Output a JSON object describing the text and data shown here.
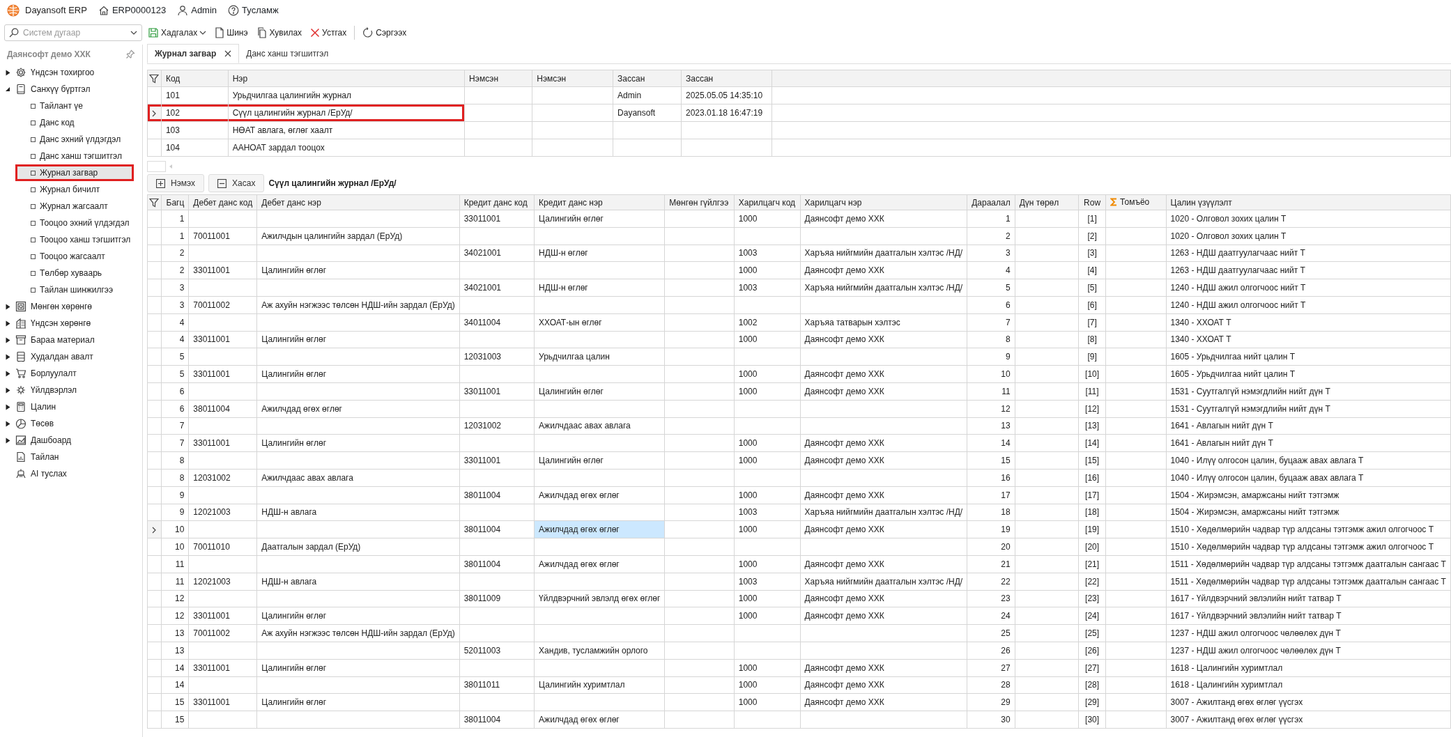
{
  "header": {
    "app_name": "Dayansoft ERP",
    "items": [
      {
        "kind": "company",
        "label": "ERP0000123"
      },
      {
        "kind": "user",
        "label": "Admin"
      },
      {
        "kind": "help",
        "label": "Тусламж"
      }
    ]
  },
  "toolbar": {
    "search": {
      "placeholder": "Систем дугаар"
    },
    "buttons": [
      {
        "kind": "save",
        "label": "Хадгалах",
        "has_menu": true
      },
      {
        "kind": "new",
        "label": "Шинэ",
        "has_menu": false
      },
      {
        "kind": "copy",
        "label": "Хувилах",
        "has_menu": false
      },
      {
        "kind": "delete",
        "label": "Устгах",
        "has_menu": false
      },
      {
        "kind": "refresh",
        "label": "Сэргээх",
        "has_menu": false
      }
    ]
  },
  "sidebar": {
    "title": "Даянсофт демо ХХК",
    "items": [
      {
        "kind": "folder",
        "label": "Үндсэн тохиргоо",
        "expanded": false
      },
      {
        "kind": "folder",
        "label": "Санхүү бүртгэл",
        "expanded": true,
        "children": [
          {
            "label": "Тайлант үе",
            "selected": false,
            "highlighted": false
          },
          {
            "label": "Данс код",
            "selected": false,
            "highlighted": false
          },
          {
            "label": "Данс эхний үлдэгдэл",
            "selected": false,
            "highlighted": false
          },
          {
            "label": "Данс ханш тэгшитгэл",
            "selected": false,
            "highlighted": false
          },
          {
            "label": "Журнал загвар",
            "selected": true,
            "highlighted": true
          },
          {
            "label": "Журнал бичилт",
            "selected": false,
            "highlighted": false
          },
          {
            "label": "Журнал жагсаалт",
            "selected": false,
            "highlighted": false
          },
          {
            "label": "Тооцоо эхний үлдэгдэл",
            "selected": false,
            "highlighted": false
          },
          {
            "label": "Тооцоо ханш тэгшитгэл",
            "selected": false,
            "highlighted": false
          },
          {
            "label": "Тооцоо жагсаалт",
            "selected": false,
            "highlighted": false
          },
          {
            "label": "Төлбөр хуваарь",
            "selected": false,
            "highlighted": false
          },
          {
            "label": "Тайлан шинжилгээ",
            "selected": false,
            "highlighted": false
          }
        ]
      },
      {
        "kind": "folder",
        "label": "Мөнгөн хөрөнгө",
        "expanded": false
      },
      {
        "kind": "folder",
        "label": "Үндсэн хөрөнгө",
        "expanded": false
      },
      {
        "kind": "folder",
        "label": "Бараа материал",
        "expanded": false
      },
      {
        "kind": "folder",
        "label": "Худалдан авалт",
        "expanded": false
      },
      {
        "kind": "folder",
        "label": "Борлуулалт",
        "expanded": false
      },
      {
        "kind": "folder",
        "label": "Үйлдвэрлэл",
        "expanded": false
      },
      {
        "kind": "folder",
        "label": "Цалин",
        "expanded": false
      },
      {
        "kind": "folder",
        "label": "Төсөв",
        "expanded": false
      },
      {
        "kind": "folder",
        "label": "Дашбоард",
        "expanded": false
      },
      {
        "kind": "leaf",
        "label": "Тайлан"
      },
      {
        "kind": "leaf",
        "label": "AI туслах"
      }
    ]
  },
  "tabs": [
    {
      "label": "Журнал загвар",
      "selected": true,
      "closable": true
    },
    {
      "label": "Данс ханш тэгшитгэл",
      "selected": false,
      "closable": false
    }
  ],
  "journal_table": {
    "columns": [
      "Код",
      "Нэр",
      "Нэмсэн",
      "Нэмсэн",
      "Зассан",
      "Зассан"
    ],
    "rows": [
      {
        "code": "101",
        "name": "Урьдчилгаа цалингийн журнал",
        "modified_by": "Admin",
        "modified_at": "2025.05.05 14:35:10",
        "selected": false,
        "highlighted": false
      },
      {
        "code": "102",
        "name": "Сүүл цалингийн журнал /ЕрУд/",
        "modified_by": "Dayansoft",
        "modified_at": "2023.01.18 16:47:19",
        "selected": true,
        "highlighted": true
      },
      {
        "code": "103",
        "name": "НӨАТ авлага, өглөг хаалт",
        "selected": false,
        "highlighted": false
      },
      {
        "code": "104",
        "name": "ААНОАТ зардал тооцох",
        "selected": false,
        "highlighted": false
      }
    ]
  },
  "detail_actions": {
    "buttons": [
      {
        "kind": "add",
        "label": "Нэмэх"
      },
      {
        "kind": "remove",
        "label": "Хасах"
      }
    ],
    "caption": "Сүүл цалингийн журнал /ЕрУд/"
  },
  "entries_table": {
    "columns": [
      {
        "label": "Багц",
        "kind": "number"
      },
      {
        "label": "Дебет данс код",
        "kind": "text"
      },
      {
        "label": "Дебет данс нэр",
        "kind": "text"
      },
      {
        "label": "Кредит данс код",
        "kind": "text"
      },
      {
        "label": "Кредит данс нэр",
        "kind": "text"
      },
      {
        "label": "Мөнгөн гүйлгээ",
        "kind": "text"
      },
      {
        "label": "Харилцагч код",
        "kind": "text"
      },
      {
        "label": "Харилцагч нэр",
        "kind": "text"
      },
      {
        "label": "Дараалал",
        "kind": "number"
      },
      {
        "label": "Дүн төрөл",
        "kind": "text"
      },
      {
        "label": "Row",
        "kind": "center"
      },
      {
        "label": "Томъёо",
        "kind": "formula"
      },
      {
        "label": "Цалин үзүүлэлт",
        "kind": "text"
      }
    ],
    "rows": [
      {
        "selected": false,
        "group": "1",
        "credit_code": "33011001",
        "credit_name": "Цалингийн өглөг",
        "partner_code": "1000",
        "partner_name": "Даянсофт демо ХХК",
        "sequence": "1",
        "row_ref": "[1]",
        "indicator": "1020 - Олговол зохих цалин Т"
      },
      {
        "selected": false,
        "group": "1",
        "debit_code": "70011001",
        "debit_name": "Ажилчдын цалингийн зардал (ЕрУд)",
        "sequence": "2",
        "row_ref": "[2]",
        "indicator": "1020 - Олговол зохих цалин Т"
      },
      {
        "selected": false,
        "group": "2",
        "credit_code": "34021001",
        "credit_name": "НДШ-н өглөг",
        "partner_code": "1003",
        "partner_name": "Харъяа нийгмийн даатгалын хэлтэс /НД/",
        "sequence": "3",
        "row_ref": "[3]",
        "indicator": "1263 - НДШ даатгуулагчаас нийт Т"
      },
      {
        "selected": false,
        "group": "2",
        "debit_code": "33011001",
        "debit_name": "Цалингийн өглөг",
        "partner_code": "1000",
        "partner_name": "Даянсофт демо ХХК",
        "sequence": "4",
        "row_ref": "[4]",
        "indicator": "1263 - НДШ даатгуулагчаас нийт Т"
      },
      {
        "selected": false,
        "group": "3",
        "credit_code": "34021001",
        "credit_name": "НДШ-н өглөг",
        "partner_code": "1003",
        "partner_name": "Харъяа нийгмийн даатгалын хэлтэс /НД/",
        "sequence": "5",
        "row_ref": "[5]",
        "indicator": "1240 - НДШ ажил олгогчоос нийт Т"
      },
      {
        "selected": false,
        "group": "3",
        "debit_code": "70011002",
        "debit_name": "Аж ахуйн нэгжээс төлсөн НДШ-ийн зардал (ЕрУд)",
        "sequence": "6",
        "row_ref": "[6]",
        "indicator": "1240 - НДШ ажил олгогчоос нийт Т"
      },
      {
        "selected": false,
        "group": "4",
        "credit_code": "34011004",
        "credit_name": "ХХОАТ-ын өглөг",
        "partner_code": "1002",
        "partner_name": "Харъяа татварын хэлтэс",
        "sequence": "7",
        "row_ref": "[7]",
        "indicator": "1340 - ХХОАТ Т"
      },
      {
        "selected": false,
        "group": "4",
        "debit_code": "33011001",
        "debit_name": "Цалингийн өглөг",
        "partner_code": "1000",
        "partner_name": "Даянсофт демо ХХК",
        "sequence": "8",
        "row_ref": "[8]",
        "indicator": "1340 - ХХОАТ Т"
      },
      {
        "selected": false,
        "group": "5",
        "credit_code": "12031003",
        "credit_name": "Урьдчилгаа цалин",
        "sequence": "9",
        "row_ref": "[9]",
        "indicator": "1605 - Урьдчилгаа нийт цалин Т"
      },
      {
        "selected": false,
        "group": "5",
        "debit_code": "33011001",
        "debit_name": "Цалингийн өглөг",
        "partner_code": "1000",
        "partner_name": "Даянсофт демо ХХК",
        "sequence": "10",
        "row_ref": "[10]",
        "indicator": "1605 - Урьдчилгаа нийт цалин Т"
      },
      {
        "selected": false,
        "group": "6",
        "credit_code": "33011001",
        "credit_name": "Цалингийн өглөг",
        "partner_code": "1000",
        "partner_name": "Даянсофт демо ХХК",
        "sequence": "11",
        "row_ref": "[11]",
        "indicator": "1531 - Суутгалгүй нэмэгдлийн нийт дүн Т"
      },
      {
        "selected": false,
        "group": "6",
        "debit_code": "38011004",
        "debit_name": "Ажилчдад өгөх өглөг",
        "sequence": "12",
        "row_ref": "[12]",
        "indicator": "1531 - Суутгалгүй нэмэгдлийн нийт дүн Т"
      },
      {
        "selected": false,
        "group": "7",
        "credit_code": "12031002",
        "credit_name": "Ажилчдаас авах авлага",
        "sequence": "13",
        "row_ref": "[13]",
        "indicator": "1641 - Авлагын нийт дүн Т"
      },
      {
        "selected": false,
        "group": "7",
        "debit_code": "33011001",
        "debit_name": "Цалингийн өглөг",
        "partner_code": "1000",
        "partner_name": "Даянсофт демо ХХК",
        "sequence": "14",
        "row_ref": "[14]",
        "indicator": "1641 - Авлагын нийт дүн Т"
      },
      {
        "selected": false,
        "group": "8",
        "credit_code": "33011001",
        "credit_name": "Цалингийн өглөг",
        "partner_code": "1000",
        "partner_name": "Даянсофт демо ХХК",
        "sequence": "15",
        "row_ref": "[15]",
        "indicator": "1040 - Илүү олгосон цалин, буцааж авах авлага Т"
      },
      {
        "selected": false,
        "group": "8",
        "debit_code": "12031002",
        "debit_name": "Ажилчдаас авах авлага",
        "sequence": "16",
        "row_ref": "[16]",
        "indicator": "1040 - Илүү олгосон цалин, буцааж авах авлага Т"
      },
      {
        "selected": false,
        "group": "9",
        "credit_code": "38011004",
        "credit_name": "Ажилчдад өгөх өглөг",
        "partner_code": "1000",
        "partner_name": "Даянсофт демо ХХК",
        "sequence": "17",
        "row_ref": "[17]",
        "indicator": "1504 - Жирэмсэн, амаржсаны нийт тэтгэмж"
      },
      {
        "selected": false,
        "group": "9",
        "debit_code": "12021003",
        "debit_name": "НДШ-н авлага",
        "partner_code": "1003",
        "partner_name": "Харъяа нийгмийн даатгалын хэлтэс /НД/",
        "sequence": "18",
        "row_ref": "[18]",
        "indicator": "1504 - Жирэмсэн, амаржсаны нийт тэтгэмж"
      },
      {
        "selected": true,
        "group": "10",
        "credit_code": "38011004",
        "credit_name": {
          "text": "Ажилчдад өгөх өглөг",
          "focused": true
        },
        "partner_code": "1000",
        "partner_name": "Даянсофт демо ХХК",
        "sequence": "19",
        "row_ref": "[19]",
        "indicator": "1510 - Хөдөлмөрийн чадвар түр алдсаны тэтгэмж ажил олгогчоос Т"
      },
      {
        "selected": false,
        "group": "10",
        "debit_code": "70011010",
        "debit_name": "Даатгалын зардал (ЕрУд)",
        "sequence": "20",
        "row_ref": "[20]",
        "indicator": "1510 - Хөдөлмөрийн чадвар түр алдсаны тэтгэмж ажил олгогчоос Т"
      },
      {
        "selected": false,
        "group": "11",
        "credit_code": "38011004",
        "credit_name": "Ажилчдад өгөх өглөг",
        "partner_code": "1000",
        "partner_name": "Даянсофт демо ХХК",
        "sequence": "21",
        "row_ref": "[21]",
        "indicator": "1511 - Хөдөлмөрийн чадвар түр алдсаны тэтгэмж даатгалын сангаас Т"
      },
      {
        "selected": false,
        "group": "11",
        "debit_code": "12021003",
        "debit_name": "НДШ-н авлага",
        "partner_code": "1003",
        "partner_name": "Харъяа нийгмийн даатгалын хэлтэс /НД/",
        "sequence": "22",
        "row_ref": "[22]",
        "indicator": "1511 - Хөдөлмөрийн чадвар түр алдсаны тэтгэмж даатгалын сангаас Т"
      },
      {
        "selected": false,
        "group": "12",
        "credit_code": "38011009",
        "credit_name": "Үйлдвэрчний эвлэлд өгөх өглөг",
        "partner_code": "1000",
        "partner_name": "Даянсофт демо ХХК",
        "sequence": "23",
        "row_ref": "[23]",
        "indicator": "1617 - Үйлдвэрчний эвлэлийн нийт татвар Т"
      },
      {
        "selected": false,
        "group": "12",
        "debit_code": "33011001",
        "debit_name": "Цалингийн өглөг",
        "partner_code": "1000",
        "partner_name": "Даянсофт демо ХХК",
        "sequence": "24",
        "row_ref": "[24]",
        "indicator": "1617 - Үйлдвэрчний эвлэлийн нийт татвар Т"
      },
      {
        "selected": false,
        "group": "13",
        "debit_code": "70011002",
        "debit_name": "Аж ахуйн нэгжээс төлсөн НДШ-ийн зардал (ЕрУд)",
        "sequence": "25",
        "row_ref": "[25]",
        "indicator": "1237 - НДШ ажил олгогчоос чөлөөлөх дүн Т"
      },
      {
        "selected": false,
        "group": "13",
        "credit_code": "52011003",
        "credit_name": "Хандив, тусламжийн орлого",
        "sequence": "26",
        "row_ref": "[26]",
        "indicator": "1237 - НДШ ажил олгогчоос чөлөөлөх дүн Т"
      },
      {
        "selected": false,
        "group": "14",
        "debit_code": "33011001",
        "debit_name": "Цалингийн өглөг",
        "partner_code": "1000",
        "partner_name": "Даянсофт демо ХХК",
        "sequence": "27",
        "row_ref": "[27]",
        "indicator": "1618 - Цалингийн хуримтлал"
      },
      {
        "selected": false,
        "group": "14",
        "credit_code": "38011011",
        "credit_name": "Цалингийн хуримтлал",
        "partner_code": "1000",
        "partner_name": "Даянсофт демо ХХК",
        "sequence": "28",
        "row_ref": "[28]",
        "indicator": "1618 - Цалингийн хуримтлал"
      },
      {
        "selected": false,
        "group": "15",
        "debit_code": "33011001",
        "debit_name": "Цалингийн өглөг",
        "partner_code": "1000",
        "partner_name": "Даянсофт демо ХХК",
        "sequence": "29",
        "row_ref": "[29]",
        "indicator": "3007 - Ажилтанд өгөх өглөг үүсгэх"
      },
      {
        "selected": false,
        "group": "15",
        "credit_code": "38011004",
        "credit_name": "Ажилчдад өгөх өглөг",
        "sequence": "30",
        "row_ref": "[30]",
        "indicator": "3007 - Ажилтанд өгөх өглөг үүсгэх"
      }
    ]
  }
}
